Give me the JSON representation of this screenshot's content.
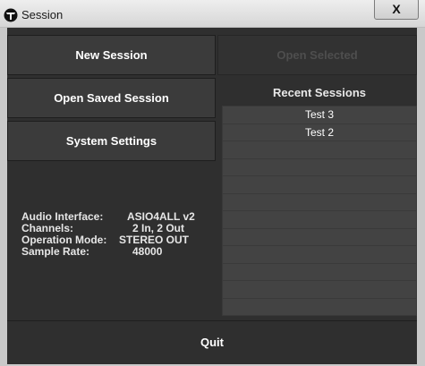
{
  "window": {
    "title": "Session",
    "close_label": "X"
  },
  "buttons": {
    "new_session": "New Session",
    "open_saved": "Open Saved Session",
    "system_settings": "System Settings",
    "open_selected": "Open Selected",
    "quit": "Quit"
  },
  "recent": {
    "title": "Recent Sessions",
    "items": [
      "Test 3",
      "Test 2",
      "",
      "",
      "",
      "",
      "",
      "",
      "",
      "",
      "",
      ""
    ]
  },
  "info": {
    "audio_interface_label": "Audio Interface:",
    "audio_interface_value": "ASIO4ALL v2",
    "channels_label": "Channels:",
    "channels_value": "2 In, 2 Out",
    "operation_mode_label": "Operation Mode:",
    "operation_mode_value": "STEREO OUT",
    "sample_rate_label": "Sample Rate:",
    "sample_rate_value": "48000"
  },
  "icons": {
    "app": "app-logo-icon"
  },
  "colors": {
    "panel_bg": "#2f2f2f",
    "button_bg": "#3b3b3b",
    "list_bg": "#434343",
    "disabled_text": "#4e4e4e"
  }
}
